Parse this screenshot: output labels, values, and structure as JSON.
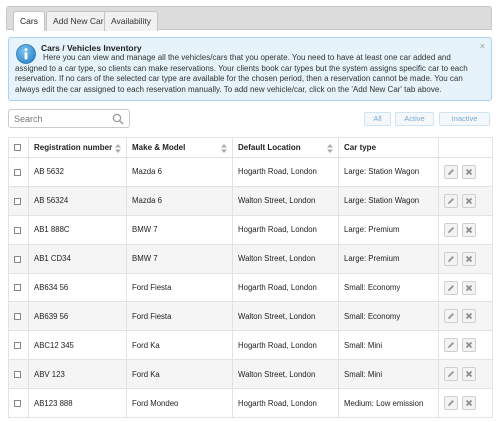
{
  "tabs": [
    {
      "label": "Cars",
      "active": true
    },
    {
      "label": "Add New Car",
      "active": false
    },
    {
      "label": "Availability",
      "active": false
    }
  ],
  "info": {
    "title": "Cars / Vehicles Inventory",
    "body": "Here you can view and manage all the vehicles/cars that you operate. You need to have at least one car added and assigned to a car type, so clients can make reservations. Your clients book car types but the system assigns specific car to each reservation. If no cars of the selected car type are available for the chosen period, then a reservation cannot be made. You can always edit the car assigned to each reservation manually. To add new vehicle/car, click on the 'Add New Car' tab above.",
    "close": "×",
    "icon": "info-icon"
  },
  "search": {
    "placeholder": "Search",
    "value": ""
  },
  "filters": [
    "All",
    "Active",
    "Inactive"
  ],
  "table": {
    "headers": [
      "Registration number",
      "Make & Model",
      "Default Location",
      "Car type"
    ],
    "rows": [
      {
        "reg": "AB 5632",
        "model": "Mazda 6",
        "location": "Hogarth Road, London",
        "type": "Large: Station Wagon"
      },
      {
        "reg": "AB 56324",
        "model": "Mazda 6",
        "location": "Walton Street, London",
        "type": "Large: Station Wagon"
      },
      {
        "reg": "AB1 888C",
        "model": "BMW 7",
        "location": "Hogarth Road, London",
        "type": "Large: Premium"
      },
      {
        "reg": "AB1 CD34",
        "model": "BMW 7",
        "location": "Walton Street, London",
        "type": "Large: Premium"
      },
      {
        "reg": "AB634 56",
        "model": "Ford Fiesta",
        "location": "Hogarth Road, London",
        "type": "Small: Economy"
      },
      {
        "reg": "AB639 56",
        "model": "Ford Fiesta",
        "location": "Walton Street, London",
        "type": "Small: Economy"
      },
      {
        "reg": "ABC12 345",
        "model": "Ford Ka",
        "location": "Hogarth Road, London",
        "type": "Small: Mini"
      },
      {
        "reg": "ABV 123",
        "model": "Ford Ka",
        "location": "Walton Street, London",
        "type": "Small: Mini"
      },
      {
        "reg": "AB123 888",
        "model": "Ford Mondeo",
        "location": "Hogarth Road, London",
        "type": "Medium: Low emission"
      }
    ]
  }
}
